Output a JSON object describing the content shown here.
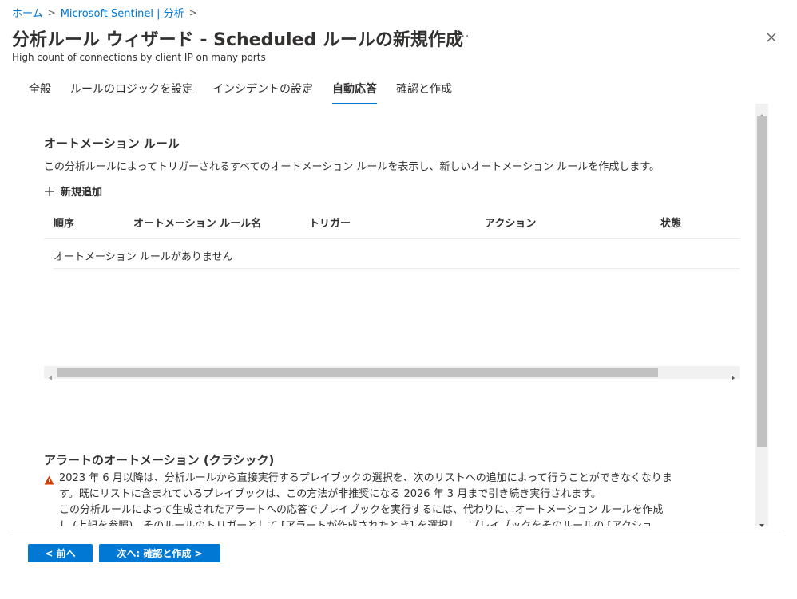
{
  "breadcrumb": {
    "items": [
      "ホーム",
      "Microsoft Sentinel | 分析"
    ]
  },
  "header": {
    "title": "分析ルール ウィザード - Scheduled ルールの新規作成",
    "ellipsis": "···",
    "subtitle": "High count of connections by client IP on many ports"
  },
  "tabs": [
    {
      "label": "全般",
      "active": false
    },
    {
      "label": "ルールのロジックを設定",
      "active": false
    },
    {
      "label": "インシデントの設定",
      "active": false
    },
    {
      "label": "自動応答",
      "active": true
    },
    {
      "label": "確認と作成",
      "active": false
    }
  ],
  "automation": {
    "title": "オートメーション ルール",
    "description": "この分析ルールによってトリガーされるすべてのオートメーション ルールを表示し、新しいオートメーション ルールを作成します。",
    "add_new": "新規追加",
    "columns": [
      "順序",
      "オートメーション ルール名",
      "トリガー",
      "アクション",
      "状態"
    ],
    "empty_text": "オートメーション ルールがありません"
  },
  "alert_automation": {
    "title": "アラートのオートメーション (クラシック)",
    "warning_lines": [
      "2023 年 6 月以降は、分析ルールから直接実行するプレイブックの選択を、次のリストへの追加によって行うことができなくなりま",
      "す。既にリストに含まれているプレイブックは、この方法が非推奨になる 2026 年 3 月まで引き続き実行されます。",
      "この分析ルールによって生成されたアラートへの応答でプレイブックを実行するには、代わりに、オートメーション ルールを作成",
      "し (上記を参照)、そのルールのトリガーとして [アラートが作成されたとき] を選択し、プレイブックをそのルールの [アクショ"
    ]
  },
  "footer": {
    "prev_label": "< 前へ",
    "next_label": "次へ: 確認と作成 >"
  },
  "colors": {
    "accent": "#0078d4",
    "warning": "#d83b01"
  }
}
